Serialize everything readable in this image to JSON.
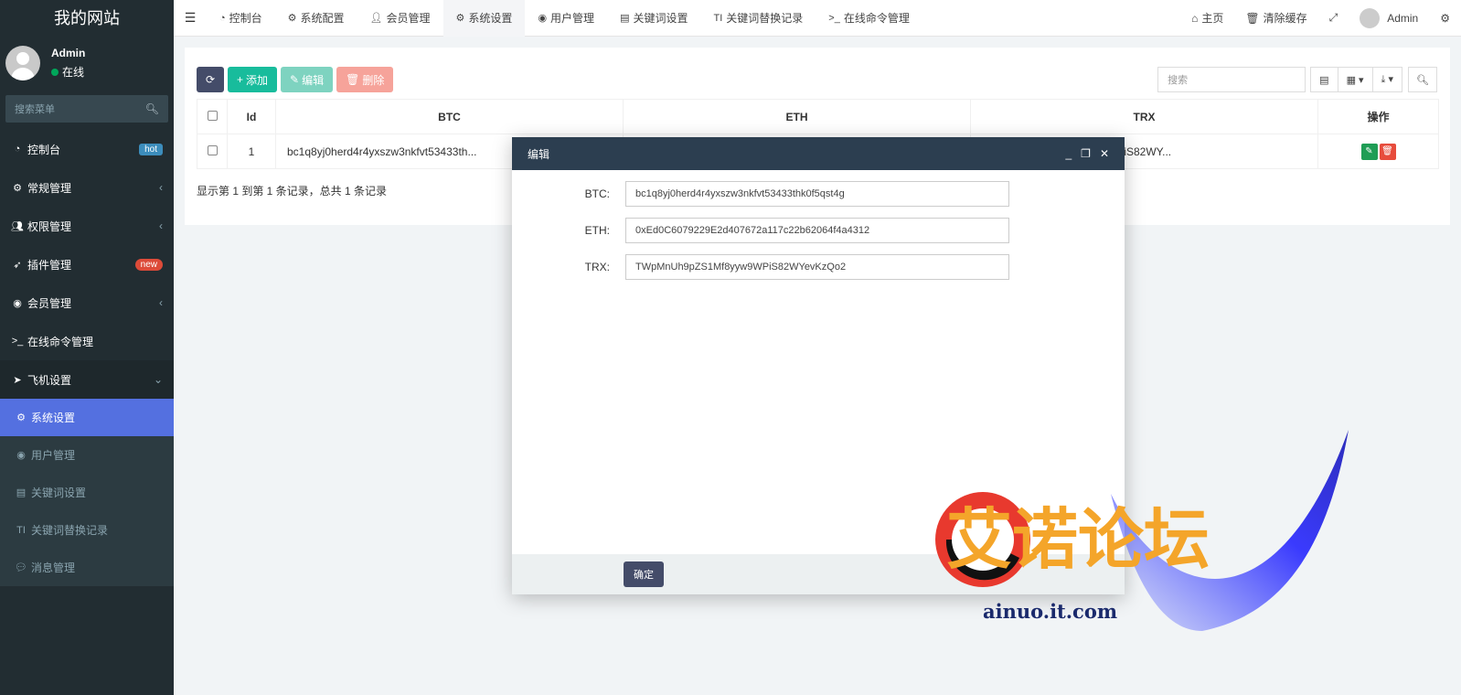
{
  "sidebar": {
    "logo": "我的网站",
    "user": {
      "name": "Admin",
      "status": "在线"
    },
    "search_placeholder": "搜索菜单",
    "items": [
      {
        "icon": "dashboard-icon",
        "label": "控制台",
        "badge": "hot"
      },
      {
        "icon": "cogs-icon",
        "label": "常规管理",
        "chevron": "‹"
      },
      {
        "icon": "users-icon",
        "label": "权限管理",
        "chevron": "‹"
      },
      {
        "icon": "rocket-icon",
        "label": "插件管理",
        "badge": "new"
      },
      {
        "icon": "user-circle-icon",
        "label": "会员管理",
        "chevron": "‹"
      },
      {
        "icon": "terminal-icon",
        "label": "在线命令管理"
      },
      {
        "icon": "telegram-icon",
        "label": "飞机设置",
        "chevron": "⌄"
      }
    ],
    "subitems": [
      {
        "icon": "gear-icon",
        "label": "系统设置",
        "active": true
      },
      {
        "icon": "user-circle-icon",
        "label": "用户管理"
      },
      {
        "icon": "file-icon",
        "label": "关键词设置"
      },
      {
        "icon": "text-icon",
        "label": "关键词替换记录"
      },
      {
        "icon": "comment-icon",
        "label": "消息管理"
      }
    ]
  },
  "topbar": {
    "tabs": [
      {
        "icon": "dashboard-icon",
        "label": "控制台"
      },
      {
        "icon": "gear-icon",
        "label": "系统配置"
      },
      {
        "icon": "user-icon",
        "label": "会员管理"
      },
      {
        "icon": "gear-icon",
        "label": "系统设置",
        "active": true
      },
      {
        "icon": "user-circle-icon",
        "label": "用户管理"
      },
      {
        "icon": "file-icon",
        "label": "关键词设置"
      },
      {
        "icon": "text-icon",
        "label": "关键词替换记录"
      },
      {
        "icon": "terminal-icon",
        "label": "在线命令管理"
      }
    ],
    "home": "主页",
    "clear_cache": "清除缓存",
    "user": "Admin"
  },
  "toolbar": {
    "add": "添加",
    "edit": "编辑",
    "delete": "删除",
    "search_placeholder": "搜索"
  },
  "table": {
    "headers": [
      "Id",
      "BTC",
      "ETH",
      "TRX",
      "操作"
    ],
    "rows": [
      {
        "id": "1",
        "btc": "bc1q8yj0herd4r4yxszw3nkfvt53433th...",
        "eth": "",
        "trx": "WPiS82WY..."
      }
    ],
    "footer": "显示第 1 到第 1 条记录，总共 1 条记录"
  },
  "modal": {
    "title": "编辑",
    "fields": [
      {
        "label": "BTC:",
        "value": "bc1q8yj0herd4r4yxszw3nkfvt53433thk0f5qst4g"
      },
      {
        "label": "ETH:",
        "value": "0xEd0C6079229E2d407672a117c22b62064f4a4312"
      },
      {
        "label": "TRX:",
        "value": "TWpMnUh9pZS1Mf8yyw9WPiS82WYevKzQo2"
      }
    ],
    "confirm": "确定"
  },
  "watermark": {
    "title": "艾诺论坛",
    "url": "ainuo.it.com"
  }
}
